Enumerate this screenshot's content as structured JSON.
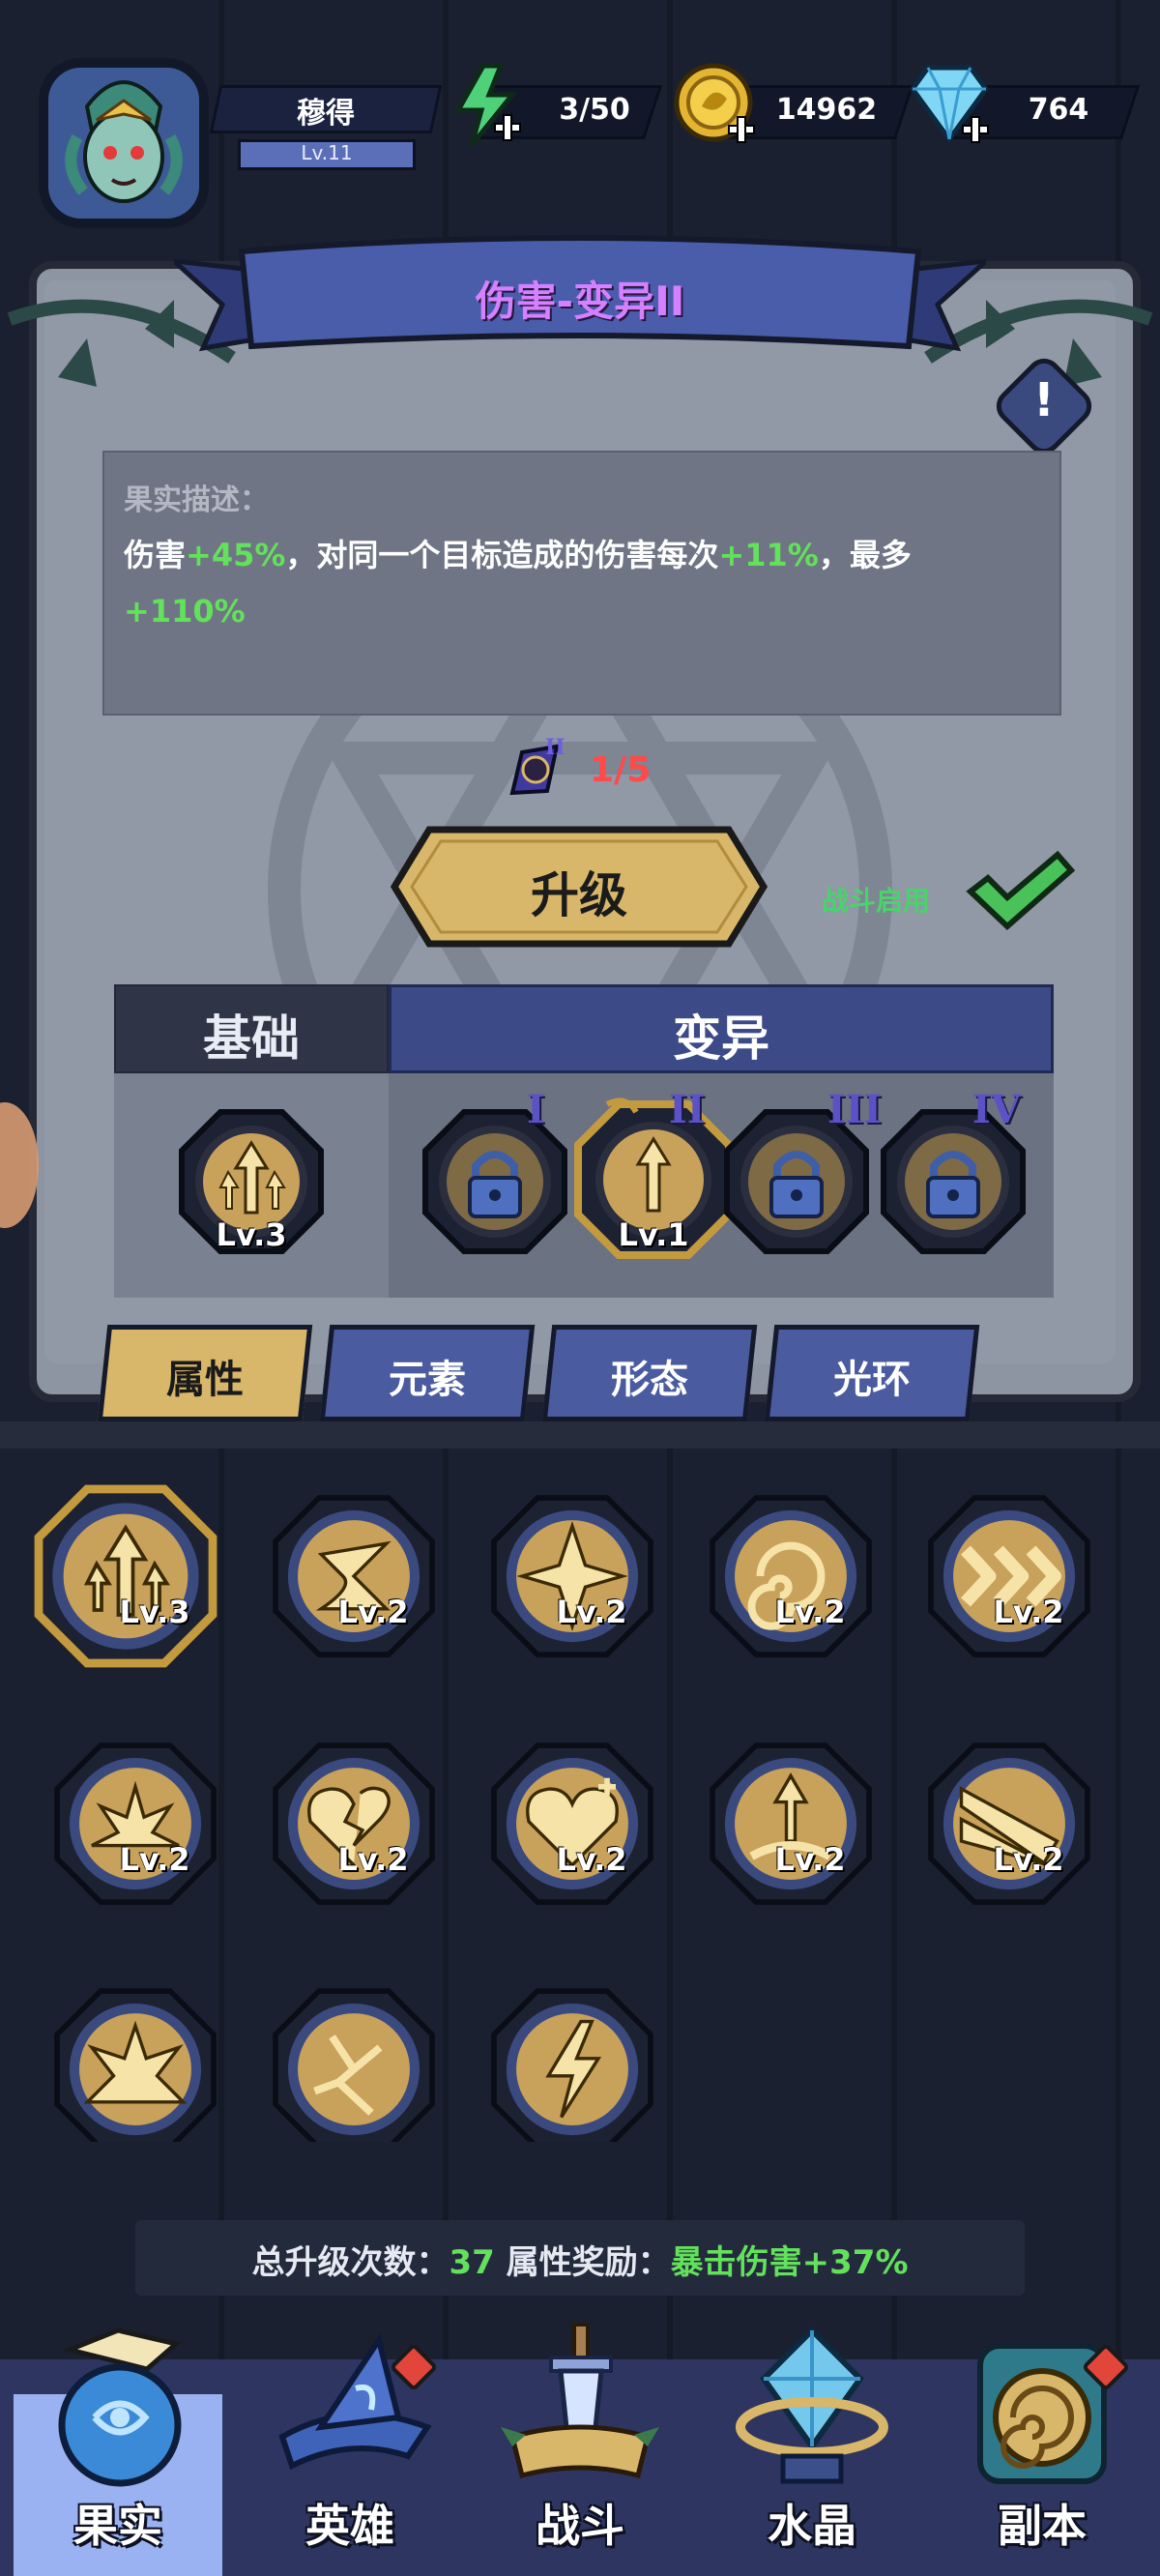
{
  "player": {
    "name": "穆得",
    "level": "Lv.11"
  },
  "resources": {
    "energy": "3/50",
    "coins": "14962",
    "gems": "764"
  },
  "fruit": {
    "title": "伤害-变异II",
    "desc_label": "果实描述：",
    "desc_parts": {
      "p1": "伤害",
      "v1": "+45%",
      "p2": "，对同一个目标造成的伤害每次",
      "v2": "+11%",
      "p3": "，最多",
      "v3": "+110%"
    },
    "progress": "1/5",
    "upgrade_label": "升级",
    "battle_enable_label": "战斗启用"
  },
  "mutation_tabs": {
    "base_label": "基础",
    "mutation_label": "变异"
  },
  "base_slot": {
    "level": "Lv.3"
  },
  "mutation_slots": [
    {
      "roman": "I",
      "level": "",
      "locked": true
    },
    {
      "roman": "II",
      "level": "Lv.1",
      "locked": false
    },
    {
      "roman": "III",
      "level": "",
      "locked": true
    },
    {
      "roman": "IV",
      "level": "",
      "locked": true
    }
  ],
  "category_tabs": [
    {
      "label": "属性",
      "active": true
    },
    {
      "label": "元素",
      "active": false
    },
    {
      "label": "形态",
      "active": false
    },
    {
      "label": "光环",
      "active": false
    }
  ],
  "fruits_grid": [
    {
      "level": "Lv.3",
      "icon": "arrows-up-icon",
      "selected": true
    },
    {
      "level": "Lv.2",
      "icon": "swirl-icon",
      "selected": false
    },
    {
      "level": "Lv.2",
      "icon": "four-arrows-icon",
      "selected": false
    },
    {
      "level": "Lv.2",
      "icon": "spiral-icon",
      "selected": false
    },
    {
      "level": "Lv.2",
      "icon": "chevrons-icon",
      "selected": false
    },
    {
      "level": "Lv.2",
      "icon": "impact-icon",
      "selected": false
    },
    {
      "level": "Lv.2",
      "icon": "broken-heart-icon",
      "selected": false
    },
    {
      "level": "Lv.2",
      "icon": "heart-plus-icon",
      "selected": false
    },
    {
      "level": "Lv.2",
      "icon": "rising-arrow-icon",
      "selected": false
    },
    {
      "level": "Lv.2",
      "icon": "beam-icon",
      "selected": false
    },
    {
      "level": "",
      "icon": "burst-icon",
      "selected": false
    },
    {
      "level": "",
      "icon": "crack-icon",
      "selected": false
    },
    {
      "level": "",
      "icon": "lightning-icon",
      "selected": false
    }
  ],
  "summary": {
    "label1": "总升级次数：",
    "count": "37",
    "label2": " 属性奖励：",
    "bonus": "暴击伤害+37%"
  },
  "bottom_nav": [
    {
      "label": "果实",
      "active": true,
      "badge": false
    },
    {
      "label": "英雄",
      "active": false,
      "badge": true
    },
    {
      "label": "战斗",
      "active": false,
      "badge": false
    },
    {
      "label": "水晶",
      "active": false,
      "badge": false
    },
    {
      "label": "副本",
      "active": false,
      "badge": true
    }
  ],
  "colors": {
    "accent_gold": "#d8b66a",
    "accent_blue": "#4a5ba0",
    "highlight_green": "#63e05c",
    "warning_red": "#ff4a4a",
    "title_purple": "#d580ff"
  }
}
